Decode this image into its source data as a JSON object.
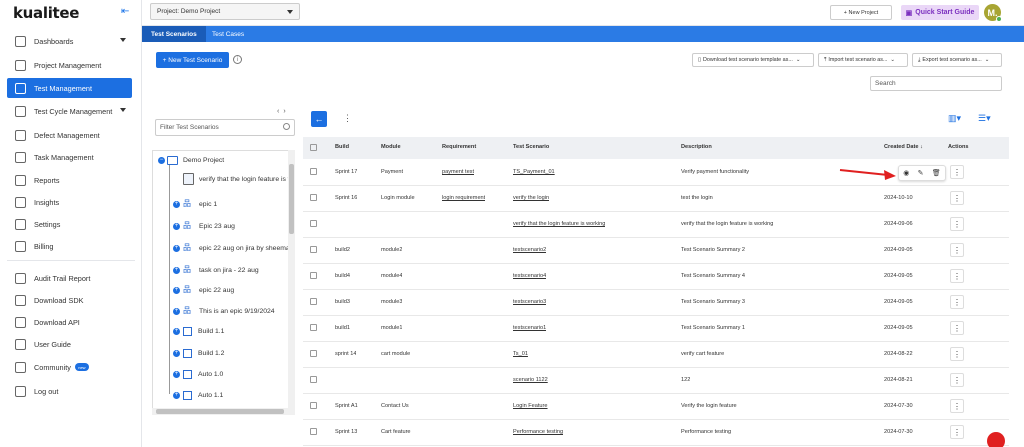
{
  "brand": {
    "logo_text": "kualitee"
  },
  "sidebar": {
    "items": [
      {
        "label": "Dashboards",
        "icon": "dashboard-icon",
        "has_caret": true
      },
      {
        "label": "Project Management",
        "icon": "project-management-icon"
      },
      {
        "label": "Test Management",
        "icon": "test-management-icon",
        "active": true
      },
      {
        "label": "Test Cycle Management",
        "icon": "test-cycle-icon",
        "has_caret": true
      },
      {
        "label": "Defect Management",
        "icon": "defect-icon"
      },
      {
        "label": "Task Management",
        "icon": "task-icon"
      },
      {
        "label": "Reports",
        "icon": "reports-icon"
      },
      {
        "label": "Insights",
        "icon": "insights-icon"
      },
      {
        "label": "Settings",
        "icon": "settings-icon"
      },
      {
        "label": "Billing",
        "icon": "billing-icon"
      },
      {
        "label": "Audit Trail Report",
        "icon": "audit-icon"
      },
      {
        "label": "Download SDK",
        "icon": "sdk-icon"
      },
      {
        "label": "Download API",
        "icon": "api-icon"
      },
      {
        "label": "User Guide",
        "icon": "user-guide-icon"
      },
      {
        "label": "Community",
        "icon": "community-icon",
        "badge": "new"
      },
      {
        "label": "Log out",
        "icon": "logout-icon"
      }
    ]
  },
  "topbar": {
    "project_label": "Project:  Demo Project",
    "new_project": "+  New Project",
    "quick_start": "Quick Start Guide",
    "avatar_initial": "M."
  },
  "tabs": [
    {
      "label": "Test Scenarios",
      "active": true
    },
    {
      "label": "Test Cases"
    }
  ],
  "toolbar": {
    "new_scenario": "+ New Test Scenario",
    "download_template": "Download test scenario template as...",
    "import": "Import test scenario as...",
    "export": "Export test scenario as...",
    "search_placeholder": "Search"
  },
  "tree": {
    "filter_placeholder": "Filter Test Scenarios",
    "root": "Demo Project",
    "child_scenario": "verify that the login feature is w",
    "nodes": [
      {
        "label": "epic 1",
        "type": "epic"
      },
      {
        "label": "Epic 23 aug",
        "type": "epic"
      },
      {
        "label": "epic 22 aug on jira by sheema",
        "type": "epic"
      },
      {
        "label": "task on jira - 22 aug",
        "type": "epic"
      },
      {
        "label": "epic 22 aug",
        "type": "epic"
      },
      {
        "label": "This is an epic 9/19/2024",
        "type": "epic"
      },
      {
        "label": "Build 1.1",
        "type": "build"
      },
      {
        "label": "Build 1.2",
        "type": "build"
      },
      {
        "label": "Auto 1.0",
        "type": "build"
      },
      {
        "label": "Auto 1.1",
        "type": "build"
      }
    ]
  },
  "table": {
    "headers": {
      "build": "Build",
      "module": "Module",
      "requirement": "Requirement",
      "scenario": "Test Scenario",
      "description": "Description",
      "created": "Created Date",
      "actions": "Actions"
    },
    "rows": [
      {
        "build": "Sprint 17",
        "module": "Payment",
        "requirement": "payment test",
        "scenario": "TS_Payment_01",
        "description": "Verify payment functionality",
        "created": ""
      },
      {
        "build": "Sprint 16",
        "module": "Login module",
        "requirement": "login requirement",
        "scenario": "verify the login",
        "description": "test the login",
        "created": "2024-10-10"
      },
      {
        "build": "",
        "module": "",
        "requirement": "",
        "scenario": "verify that the login feature is working",
        "description": "verify that the login feature is working",
        "created": "2024-09-06"
      },
      {
        "build": "build2",
        "module": "module2",
        "requirement": "",
        "scenario": "testscenario2",
        "description": "Test Scenario Summary 2",
        "created": "2024-09-05"
      },
      {
        "build": "build4",
        "module": "module4",
        "requirement": "",
        "scenario": "testscenario4",
        "description": "Test Scenario Summary 4",
        "created": "2024-09-05"
      },
      {
        "build": "build3",
        "module": "module3",
        "requirement": "",
        "scenario": "testscenario3",
        "description": "Test Scenario Summary 3",
        "created": "2024-09-05"
      },
      {
        "build": "build1",
        "module": "module1",
        "requirement": "",
        "scenario": "testscenario1",
        "description": "Test Scenario Summary 1",
        "created": "2024-09-05"
      },
      {
        "build": "sprint 14",
        "module": "cart module",
        "requirement": "",
        "scenario": "Ts_01",
        "description": "verify cart feature",
        "created": "2024-08-22"
      },
      {
        "build": "",
        "module": "",
        "requirement": "",
        "scenario": "scenario 1122",
        "description": "122",
        "created": "2024-08-21"
      },
      {
        "build": "Sprint A1",
        "module": "Contact Us",
        "requirement": "",
        "scenario": "Login Feature",
        "description": "Verify the login feature",
        "created": "2024-07-30"
      },
      {
        "build": "Sprint 13",
        "module": "Cart feature",
        "requirement": "",
        "scenario": "Performance testing",
        "description": "Performance testing",
        "created": "2024-07-30"
      }
    ]
  },
  "colors": {
    "primary": "#1c6fe1",
    "tabbar": "#2b7be5",
    "arrow": "#e02020",
    "quick_start_bg": "#ead7f7"
  }
}
